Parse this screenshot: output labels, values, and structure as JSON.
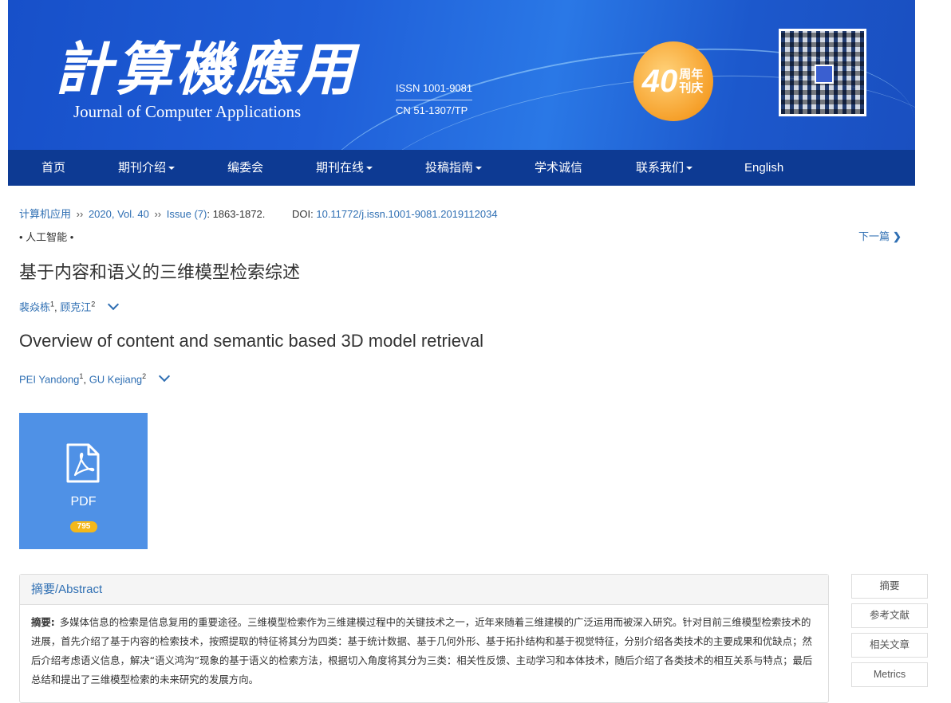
{
  "header": {
    "logo_cn": "計算機應用",
    "logo_en": "Journal of Computer Applications",
    "issn": "ISSN 1001-9081",
    "cn": "CN 51-1307/TP",
    "anniv_number": "40",
    "anniv_text": "周年刊庆",
    "qr_icon": "qr-code-icon"
  },
  "nav": {
    "items": [
      {
        "label": "首页",
        "dropdown": false
      },
      {
        "label": "期刊介绍",
        "dropdown": true
      },
      {
        "label": "编委会",
        "dropdown": false
      },
      {
        "label": "期刊在线",
        "dropdown": true
      },
      {
        "label": "投稿指南",
        "dropdown": true
      },
      {
        "label": "学术诚信",
        "dropdown": false
      },
      {
        "label": "联系我们",
        "dropdown": true
      },
      {
        "label": "English",
        "dropdown": false
      }
    ]
  },
  "breadcrumb": {
    "journal": "计算机应用",
    "volume": "2020, Vol. 40",
    "issue": "Issue (7)",
    "pages": ": 1863-1872.",
    "doi_label": "DOI:",
    "doi": "10.11772/j.issn.1001-9081.2019112034",
    "sep": "››"
  },
  "article": {
    "category": "• 人工智能 •",
    "next_label": "下一篇",
    "title_cn": "基于内容和语义的三维模型检索综述",
    "authors_cn": [
      {
        "name": "裴焱栋",
        "aff": "1"
      },
      {
        "name": "顾克江",
        "aff": "2"
      }
    ],
    "title_en": "Overview of content and semantic based 3D model retrieval",
    "authors_en": [
      {
        "name": "PEI Yandong",
        "aff": "1"
      },
      {
        "name": "GU Kejiang",
        "aff": "2"
      }
    ],
    "comma": ","
  },
  "pdf": {
    "label": "PDF",
    "count": "795",
    "icon": "pdf-file-icon"
  },
  "abstract": {
    "heading": "摘要/Abstract",
    "lead": "摘要:",
    "text": "多媒体信息的检索是信息复用的重要途径。三维模型检索作为三维建模过程中的关键技术之一，近年来随着三维建模的广泛运用而被深入研究。针对目前三维模型检索技术的进展，首先介绍了基于内容的检索技术，按照提取的特征将其分为四类：基于统计数据、基于几何外形、基于拓扑结构和基于视觉特征，分别介绍各类技术的主要成果和优缺点；然后介绍考虑语义信息，解决“语义鸿沟”现象的基于语义的检索方法，根据切入角度将其分为三类：相关性反馈、主动学习和本体技术，随后介绍了各类技术的相互关系与特点；最后总结和提出了三维模型检索的未来研究的发展方向。"
  },
  "side_nav": [
    "摘要",
    "参考文献",
    "相关文章",
    "Metrics"
  ],
  "colors": {
    "nav_bg": "#0d3a93",
    "link": "#2f6fb3",
    "pdf_tile": "#4f91e6",
    "badge": "#f4b81a"
  }
}
